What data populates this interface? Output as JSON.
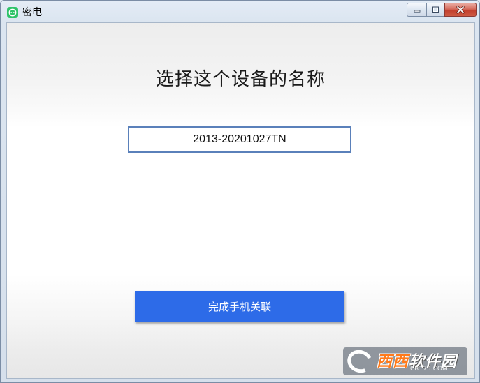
{
  "window": {
    "title": "密电",
    "icon": "chat-bubble-icon",
    "controls": {
      "minimize": "minimize-icon",
      "maximize": "maximize-icon",
      "close": "close-icon"
    }
  },
  "main": {
    "heading": "选择这个设备的名称",
    "device_name_value": "2013-20201027TN",
    "complete_button_label": "完成手机关联"
  },
  "watermark": {
    "text_main": "西西",
    "text_part2": "软件园",
    "text_sub": "CR173.COM"
  },
  "colors": {
    "accent": "#2d6be8",
    "app_icon": "#2fc36a",
    "input_border": "#5a80ba"
  }
}
